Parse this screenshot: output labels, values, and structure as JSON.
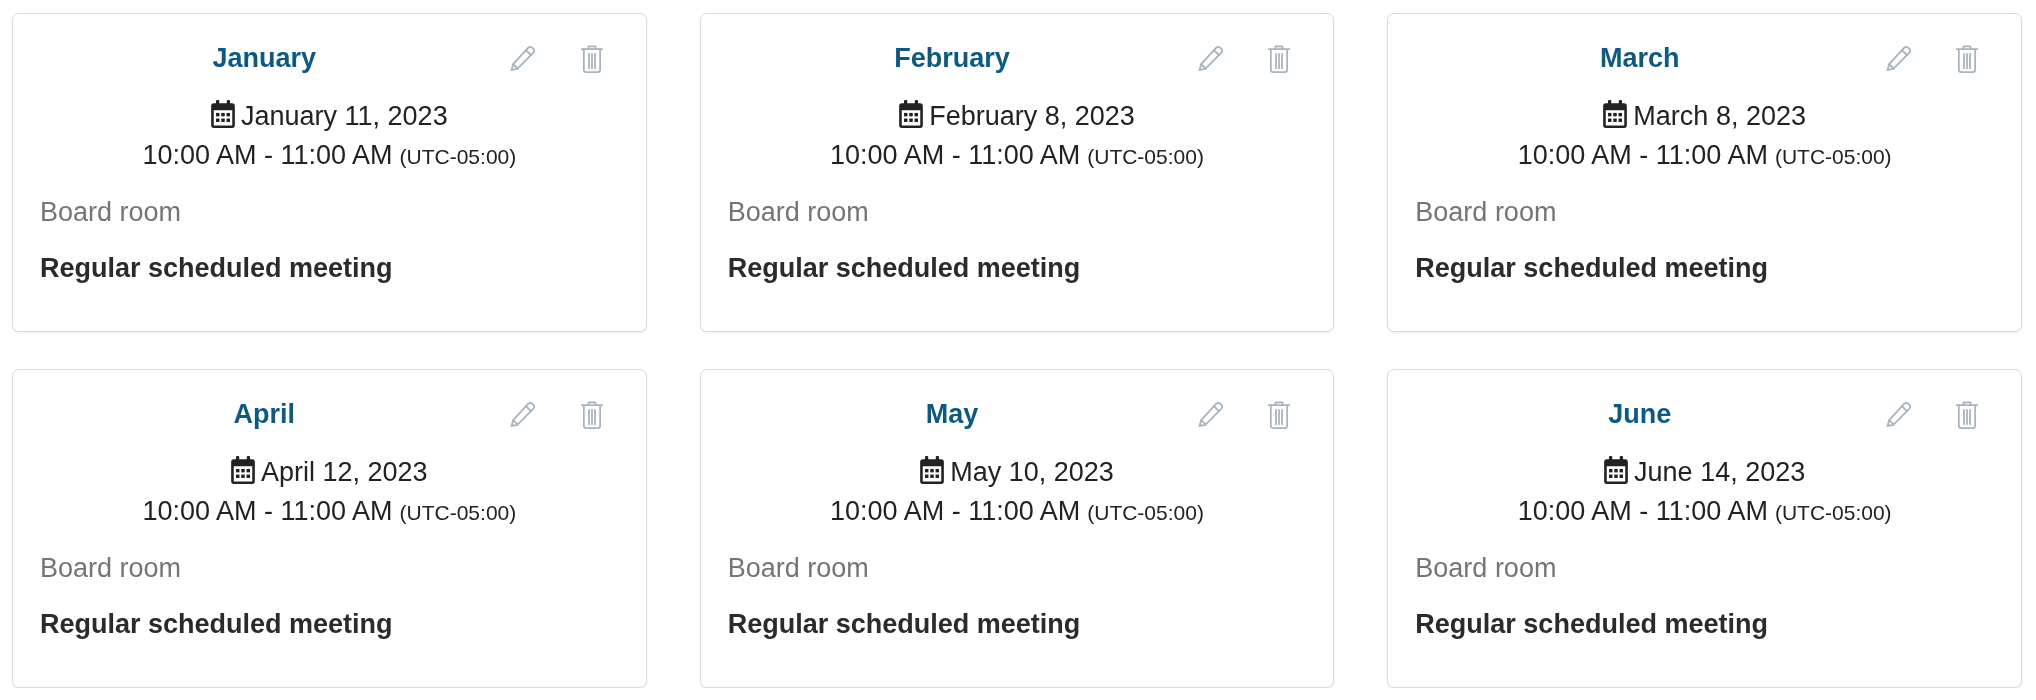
{
  "events": [
    {
      "title": "January",
      "date": "January 11, 2023",
      "time": "10:00 AM - 11:00 AM",
      "timezone": "(UTC-05:00)",
      "location": "Board room",
      "description": "Regular scheduled meeting"
    },
    {
      "title": "February",
      "date": "February 8, 2023",
      "time": "10:00 AM - 11:00 AM",
      "timezone": "(UTC-05:00)",
      "location": "Board room",
      "description": "Regular scheduled meeting"
    },
    {
      "title": "March",
      "date": "March 8, 2023",
      "time": "10:00 AM - 11:00 AM",
      "timezone": "(UTC-05:00)",
      "location": "Board room",
      "description": "Regular scheduled meeting"
    },
    {
      "title": "April",
      "date": "April 12, 2023",
      "time": "10:00 AM - 11:00 AM",
      "timezone": "(UTC-05:00)",
      "location": "Board room",
      "description": "Regular scheduled meeting"
    },
    {
      "title": "May",
      "date": "May 10, 2023",
      "time": "10:00 AM - 11:00 AM",
      "timezone": "(UTC-05:00)",
      "location": "Board room",
      "description": "Regular scheduled meeting"
    },
    {
      "title": "June",
      "date": "June 14, 2023",
      "time": "10:00 AM - 11:00 AM",
      "timezone": "(UTC-05:00)",
      "location": "Board room",
      "description": "Regular scheduled meeting"
    }
  ]
}
